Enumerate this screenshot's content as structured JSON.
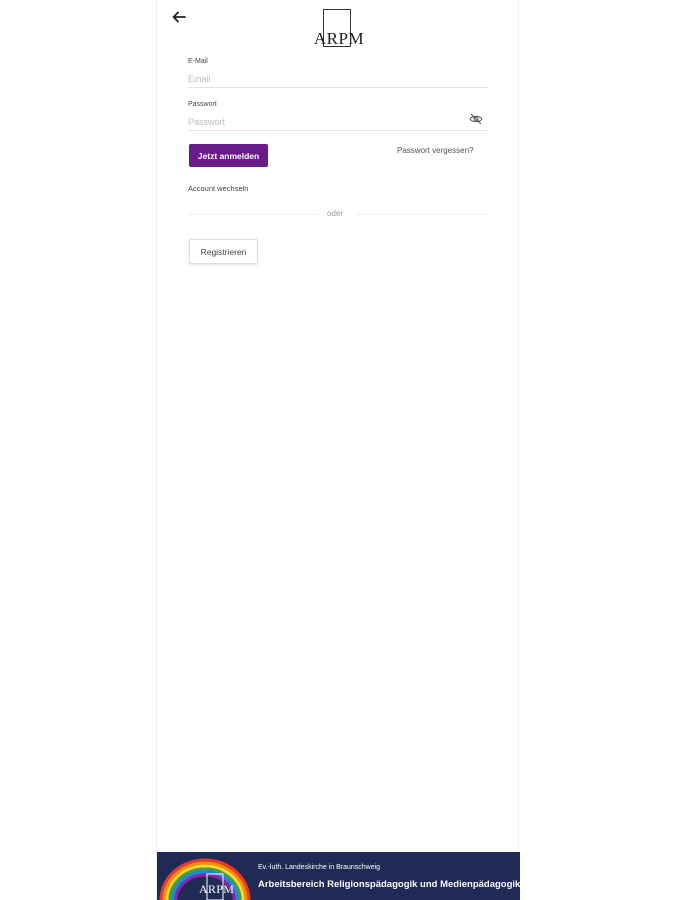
{
  "header": {
    "back_icon": "arrow-left-icon",
    "logo_text": "ARPM"
  },
  "form": {
    "email": {
      "label": "E-Mail",
      "placeholder": "Email",
      "value": ""
    },
    "password": {
      "label": "Passwort",
      "placeholder": "Passwort",
      "value": "",
      "toggle_icon": "eye-off-icon"
    },
    "login_label": "Jetzt anmelden",
    "forgot_label": "Passwort vergessen?",
    "switch_account_label": "Account wechseln",
    "divider_label": "oder",
    "register_label": "Registrieren"
  },
  "footer": {
    "logo_text": "ARPM",
    "line1": "Ev.-luth. Landeskirche in Braunschweig",
    "line2": "Arbeitsbereich Religionspädagogik und Medienpädagogik"
  },
  "colors": {
    "primary": "#6a1b8a",
    "footer_bg": "#1f2a55"
  }
}
